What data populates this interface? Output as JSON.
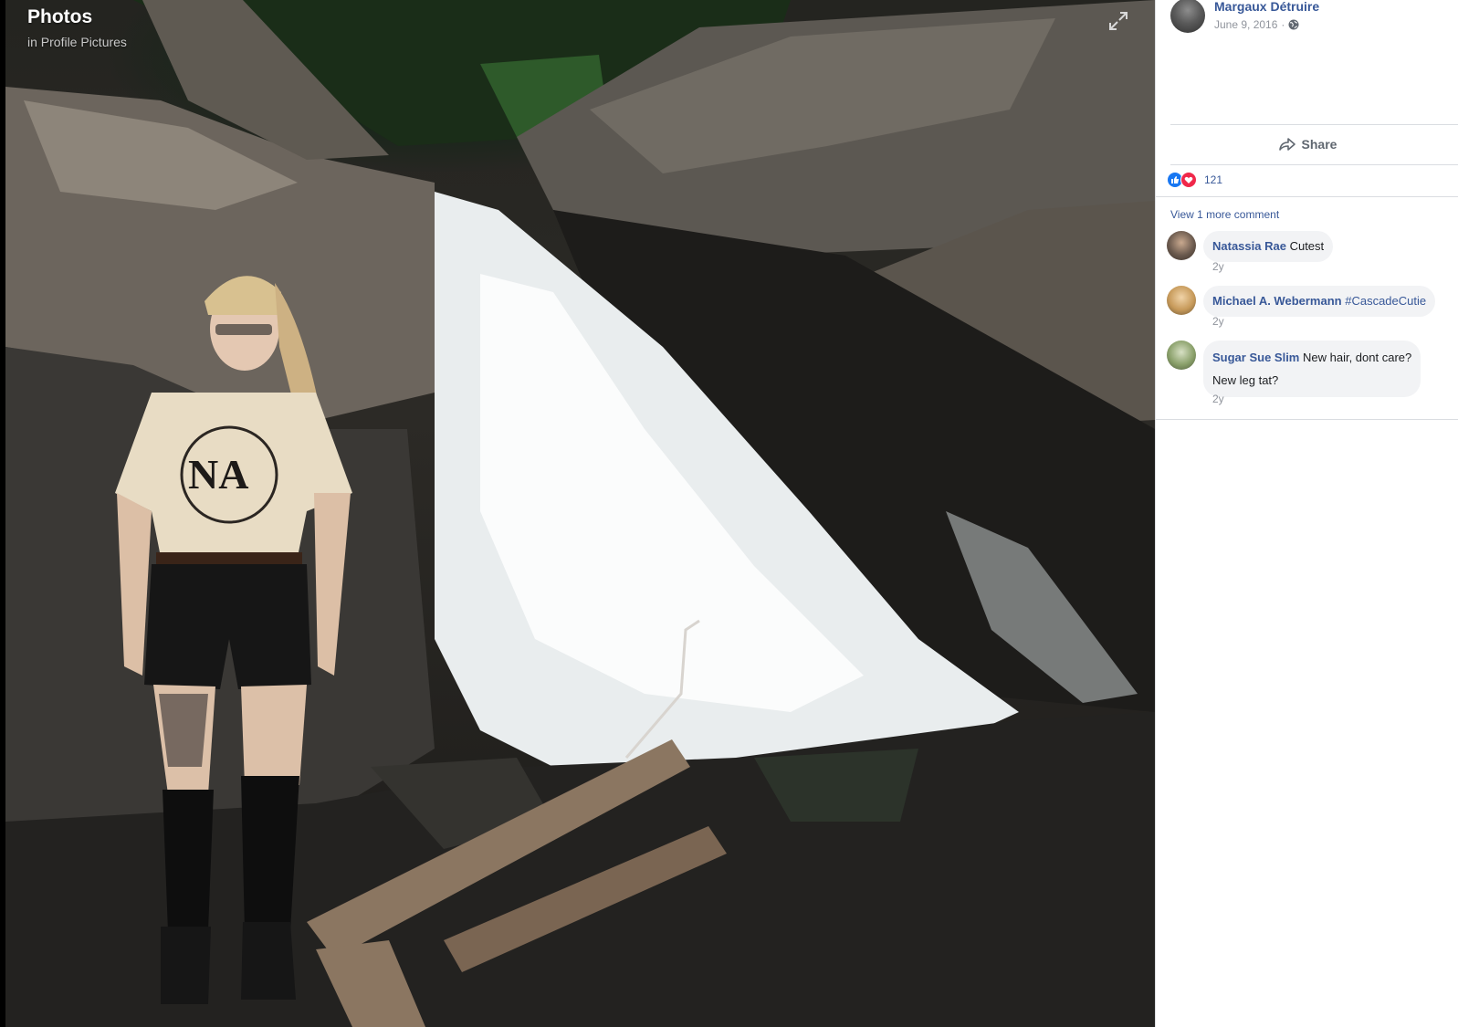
{
  "stage": {
    "title": "Photos",
    "subtitle": "in Profile Pictures",
    "expand_icon": "expand-icon"
  },
  "post": {
    "author": "Margaux Détruire",
    "date": "June 9, 2016",
    "date_separator": "·",
    "privacy_icon": "globe-icon",
    "share_label": "Share",
    "reaction_count": "121",
    "reactions": [
      "like",
      "love"
    ],
    "view_more_label": "View 1 more comment"
  },
  "comments": [
    {
      "author": "Natassia Rae",
      "text": "Cutest",
      "time": "2y",
      "avatar_color": "#6b5a4e"
    },
    {
      "author": "Michael A. Webermann",
      "tag": "#CascadeCutie",
      "time": "2y",
      "avatar_color": "#c79a5a"
    },
    {
      "author": "Sugar Sue Slim",
      "text": "New hair, dont care?",
      "text2": "New leg tat?",
      "time": "2y",
      "avatar_color": "#8aa06a"
    }
  ],
  "colors": {
    "link": "#385898",
    "meta": "#90949c",
    "bubble": "#f2f3f5",
    "like": "#1877f2",
    "love": "#f0284a"
  }
}
